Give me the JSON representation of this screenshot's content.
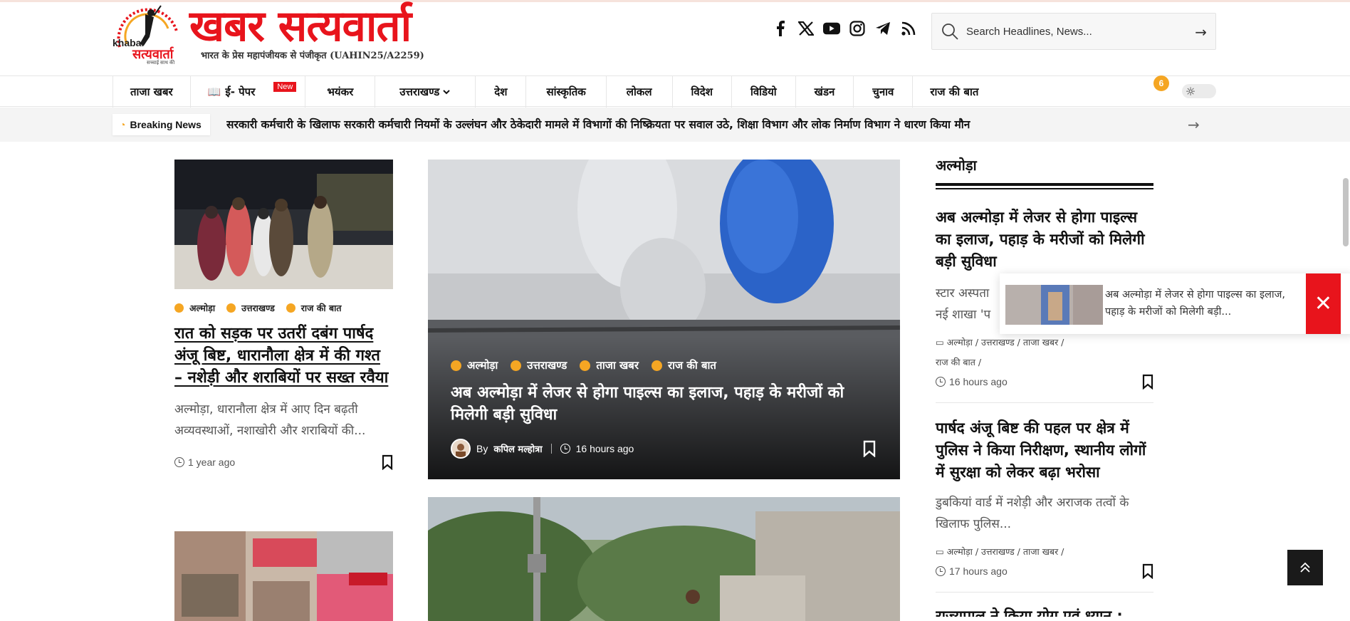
{
  "header": {
    "logo_title": "खबर सत्यवार्ता",
    "logo_subtitle": "भारत के प्रेस महापंजीयक से पंजीकृत (UAHIN25/A2259)",
    "logo_small_khabar": "khabar",
    "logo_small_satya": "सत्यवार्ता",
    "logo_tagline": "सच्चाई साथ की",
    "socials": [
      "facebook-icon",
      "x-icon",
      "youtube-icon",
      "instagram-icon",
      "telegram-icon",
      "rss-icon"
    ],
    "search_placeholder": "Search Headlines, News..."
  },
  "nav": {
    "items": [
      "ताजा खबर",
      "ई- पेपर",
      "भयंकर",
      "उत्तराखण्ड",
      "देश",
      "सांस्कृतिक",
      "लोकल",
      "विदेश",
      "विडियो",
      "खंडन",
      "चुनाव",
      "राज की बात"
    ],
    "new_badge": "New",
    "notification_count": "6"
  },
  "breaking": {
    "label": "Breaking News",
    "text": "सरकारी कर्मचारी के खिलाफ सरकारी कर्मचारी नियमों के उल्लंघन और ठेकेदारी मामले में विभागों की निष्क्रियता पर सवाल उठे, शिक्षा विभाग और लोक निर्माण विभाग ने धारण किया मौन"
  },
  "left_card": {
    "cats": [
      "अल्मोड़ा",
      "उत्तराखण्ड",
      "राज की बात"
    ],
    "title": "रात को सड़क पर उतरीं दबंग पार्षद अंजू बिष्ट, धारानौला क्षेत्र में की गश्त – नशेड़ी और शराबियों पर सख्त रवैया",
    "excerpt": "अल्मोड़ा, धारानौला क्षेत्र में आए दिन बढ़ती अव्यवस्थाओं, नशाखोरी और शराबियों की...",
    "time": "1 year ago"
  },
  "hero": {
    "cats": [
      "अल्मोड़ा",
      "उत्तराखण्ड",
      "ताजा खबर",
      "राज की बात"
    ],
    "title": "अब अल्मोड़ा में लेजर से होगा पाइल्स का इलाज, पहाड़ के मरीजों को मिलेगी बड़ी सुविधा",
    "by": "By",
    "author": "कपिल मल्होत्रा",
    "time": "16 hours ago"
  },
  "right": {
    "section": "अल्मोड़ा",
    "post1": {
      "title": "अब अल्मोड़ा में लेजर से होगा पाइल्स का इलाज, पहाड़ के मरीजों को मिलेगी बड़ी सुविधा",
      "excerpt_a": "स्टार अस्पता",
      "excerpt_b": "नई शाखा 'प",
      "cats_line1": "अल्मोड़ा / उत्तराखण्ड / ताजा खबर /",
      "cats_line2": "राज की बात /",
      "time": "16 hours ago"
    },
    "post2": {
      "title": "पार्षद अंजू बिष्ट की पहल पर क्षेत्र में पुलिस ने किया निरीक्षण, स्थानीय लोगों में सुरक्षा को लेकर बढ़ा भरोसा",
      "excerpt": "डुबकियां वार्ड में नशेड़ी और अराजक तत्वों के खिलाफ पुलिस...",
      "cats": "अल्मोड़ा / उत्तराखण्ड / ताजा खबर /",
      "time": "17 hours ago"
    },
    "post3_title_peek": "राज्यपाल ने किया योग एवं ध्यान :"
  },
  "popup": {
    "text": "अब अल्मोड़ा में लेजर से होगा पाइल्स का इलाज, पहाड़ के मरीजों को मिलेगी बड़ी...",
    "close": "✕"
  },
  "colors": {
    "brand_red": "#e8141c",
    "accent_orange": "#f5a623"
  }
}
